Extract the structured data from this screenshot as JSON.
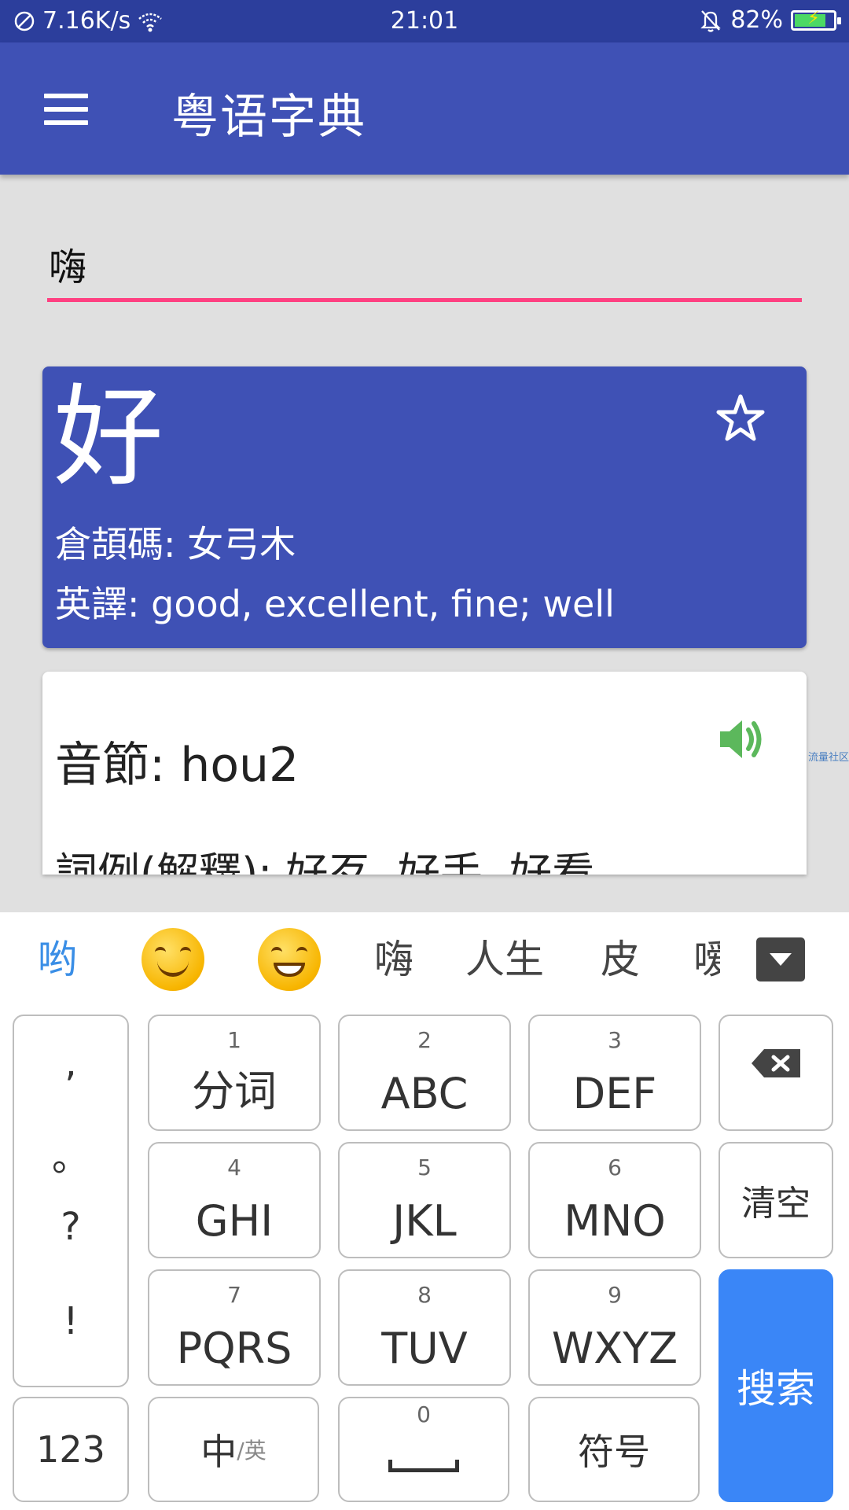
{
  "status_bar": {
    "network_speed": "7.16K/s",
    "time": "21:01",
    "battery_percent": "82%",
    "battery_level": 0.82,
    "icons": [
      "no-sim-icon",
      "wifi-icon",
      "muted-bell-icon",
      "battery-icon"
    ]
  },
  "app_bar": {
    "title": "粤语字典",
    "menu_icon": "hamburger-menu-icon"
  },
  "search": {
    "value": "嗨",
    "placeholder": ""
  },
  "result": {
    "character": "好",
    "cangjie": "倉頡碼: 女弓木",
    "english": "英譯: good, excellent, fine; well",
    "favorite_icon": "star-outline-icon",
    "syllable": "音節: hou2",
    "examples": "詞例(解釋): 好歹, 好手, 好看",
    "speaker_icon": "speaker-icon",
    "speaker_color": "#5cb85c"
  },
  "watermark": "流量社区",
  "keyboard": {
    "candidates": [
      "哟",
      "嗨",
      "人生",
      "皮",
      "嗳"
    ],
    "emoji_candidates": [
      "smiling-face-emoji",
      "grinning-face-emoji"
    ],
    "punctuation": [
      ",",
      "。",
      "?",
      "!"
    ],
    "keys": [
      {
        "num": "1",
        "label": "分词"
      },
      {
        "num": "2",
        "label": "ABC"
      },
      {
        "num": "3",
        "label": "DEF"
      },
      {
        "num": "4",
        "label": "GHI"
      },
      {
        "num": "5",
        "label": "JKL"
      },
      {
        "num": "6",
        "label": "MNO"
      },
      {
        "num": "7",
        "label": "PQRS"
      },
      {
        "num": "8",
        "label": "TUV"
      },
      {
        "num": "9",
        "label": "WXYZ"
      }
    ],
    "clear_label": "清空",
    "search_label": "搜索",
    "numeric_label": "123",
    "lang_label_main": "中",
    "lang_label_sub": "/英",
    "space_num": "0",
    "symbol_label": "符号",
    "accent_color": "#3a86f7"
  }
}
